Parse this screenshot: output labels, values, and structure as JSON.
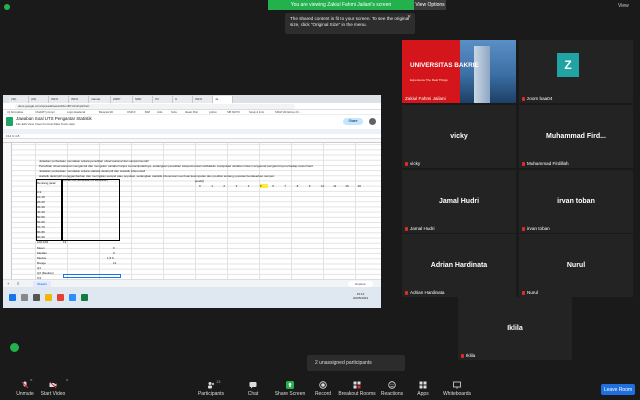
{
  "banner": {
    "text": "You are viewing Zakiul Fahmi Jailani's screen",
    "view_options": "View Options",
    "view": "View"
  },
  "tooltip": {
    "text": "The shared content is fit to your screen. To see the original size, click \"Original Size\" in the menu."
  },
  "shared_screen": {
    "tabs": [
      "(49)",
      "(23)",
      "INFO",
      "INFO",
      "mamat",
      "ZIZIP",
      "SDD",
      "XX",
      "U",
      "INFO",
      "Ja"
    ],
    "url": "docs.google.com/spreadsheets/d/1nxBYmFxhqGXaV...",
    "bookmarks": [
      "Uji Normalitas",
      "ChatGPT prompt",
      "Login Akademik",
      "Beranda SD",
      "OSM R",
      "BAP",
      "Jobs",
      "Suhu",
      "Idealo Pipit",
      "python",
      "SIB SM PK",
      "Setup & Intro",
      "SDGP Workshop 20..."
    ],
    "doc_title": "Jawaban Soal UTS Pengantar Statistik",
    "menu": "File  Edit  View  Insert  Format  Data  Tools  Help",
    "share_label": "Share",
    "cell_ref": "F12   fx  4.8",
    "questions": [
      "Jelaskan perbedaan mendasar antara penelitian observasional dan eksperimental!",
      "Penelitian observasional mengamati dan mengukur variabel tanpa memanipulasinya, sedangkan penelitian eksperimental melibatkan manipulasi variabel untuk mengamati pengaruhnya terhadap suatu hasil.",
      "Jelaskan perbedaan mendasar antara statistik deskriptif dan statistik inferensial!",
      "statistik deskriptif menggambarkan dan meringkas sampel atau populasi, sedangkan statistik inferensial membuat kesimpulan dan prediksi tentang populasi berdasarkan sampel."
    ],
    "freq_header": [
      "Rentang jarak",
      "Jumlah truk (kecepatan bin kecepatan)"
    ],
    "row_labels": [
      "0-9",
      "10-19",
      "20-29",
      "30-39",
      "40-49",
      "50-59",
      "60-69",
      "70-79",
      "80-89",
      "90-99",
      "100-109"
    ],
    "stats_labels": [
      "Mean",
      "Median",
      "Modus",
      "Range",
      "Q1",
      "Q2 (Median)",
      "Q3",
      "IR"
    ],
    "stats_values": [
      "0",
      "0",
      "1 8 9",
      "12",
      "",
      "",
      "",
      ""
    ],
    "total": "13",
    "series_label": "jarak(i)",
    "series_row": [
      "0",
      "1",
      "2",
      "3",
      "4",
      "5",
      "6",
      "7",
      "8",
      "9",
      "10",
      "11",
      "15",
      "20"
    ],
    "sheet_tab": "Sheet1",
    "explore": "Explore",
    "time": "16:10",
    "date": "20/05/2023"
  },
  "participants": [
    {
      "name": "Zakiul Fahmi Jailani",
      "kind": "slide",
      "slide_title": "UNIVERSITAS BAKRIE",
      "slide_sub": "Experience The Real Things"
    },
    {
      "name": "zoom baa04",
      "kind": "avatar",
      "avatar": "Z"
    },
    {
      "name": "vicky",
      "big": "vicky"
    },
    {
      "name": "Muhammad Firdillah",
      "big": "Muhammad Fird..."
    },
    {
      "name": "Jamal Hudri",
      "big": "Jamal Hudri"
    },
    {
      "name": "irvan toban",
      "big": "irvan toban"
    },
    {
      "name": "Adrian Hardinata",
      "big": "Adrian Hardinata"
    },
    {
      "name": "Nurul",
      "big": "Nurul"
    },
    {
      "name": "Iklila",
      "big": "Iklila"
    }
  ],
  "unassigned": "2 unassigned participants",
  "toolbar": {
    "unmute": "Unmute",
    "start_video": "Start Video",
    "participants": "Participants",
    "participants_count": "13",
    "chat": "Chat",
    "share_screen": "Share Screen",
    "record": "Record",
    "breakout": "Breakout Rooms",
    "reactions": "Reactions",
    "apps": "Apps",
    "whiteboards": "Whiteboards",
    "leave": "Leave Room"
  }
}
